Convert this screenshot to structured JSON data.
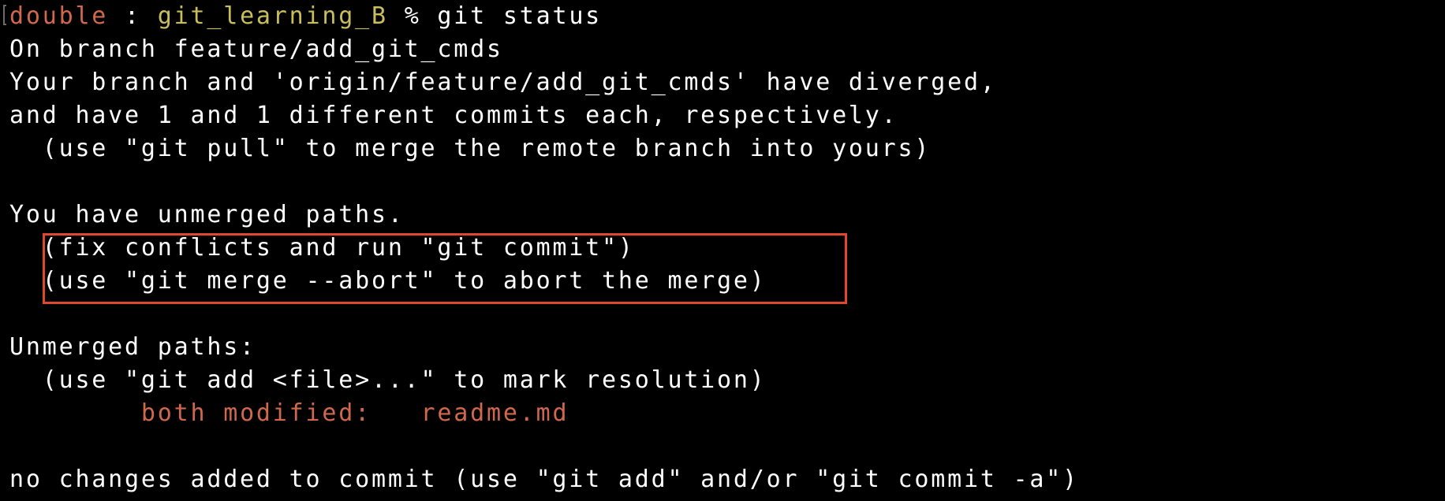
{
  "prompt": {
    "user": "double",
    "separator": " : ",
    "directory": "git_learning_B",
    "symbol": " % ",
    "command": "git status"
  },
  "lines": [
    "On branch feature/add_git_cmds",
    "Your branch and 'origin/feature/add_git_cmds' have diverged,",
    "and have 1 and 1 different commits each, respectively.",
    "  (use \"git pull\" to merge the remote branch into yours)",
    "",
    "You have unmerged paths.",
    "  (fix conflicts and run \"git commit\")",
    "  (use \"git merge --abort\" to abort the merge)",
    "",
    "Unmerged paths:",
    "  (use \"git add <file>...\" to mark resolution)"
  ],
  "modified_line": {
    "indent": "        ",
    "text": "both modified:   readme.md"
  },
  "final_line": "no changes added to commit (use \"git add\" and/or \"git commit -a\")",
  "colors": {
    "background": "#000000",
    "foreground": "#ffffff",
    "user": "#d0684e",
    "directory": "#c9be5b",
    "modified": "#d0684e",
    "highlight_border": "#e0472e"
  }
}
